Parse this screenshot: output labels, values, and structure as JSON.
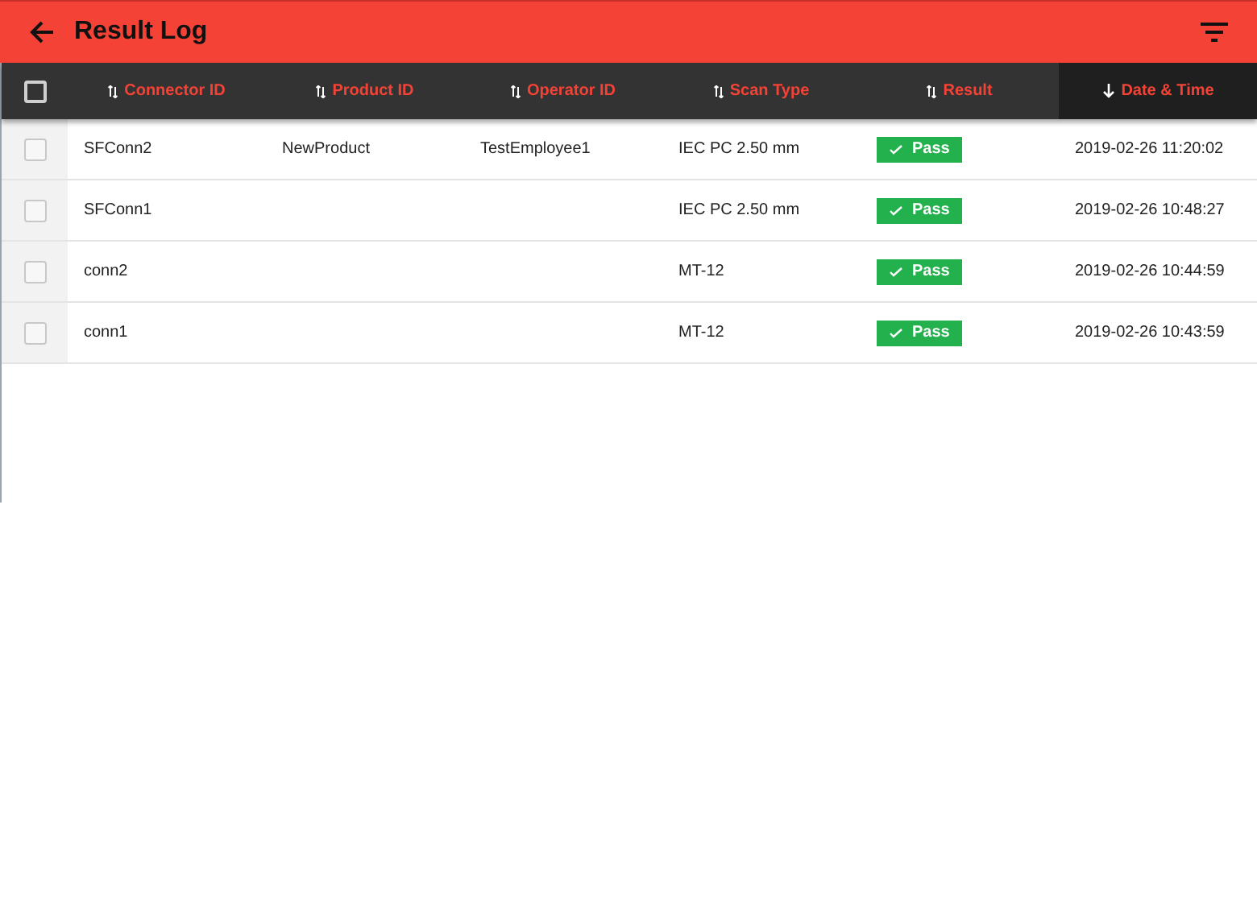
{
  "app_bar": {
    "title": "Result Log"
  },
  "table": {
    "select_all": {
      "checked": false
    },
    "columns": [
      {
        "label": "Connector ID",
        "selected": false
      },
      {
        "label": "Product ID",
        "selected": false
      },
      {
        "label": "Operator ID",
        "selected": false
      },
      {
        "label": "Scan Type",
        "selected": false
      },
      {
        "label": "Result",
        "selected": false
      },
      {
        "label": "Date & Time",
        "selected": true
      }
    ],
    "rows": [
      {
        "checked": false,
        "connector_id": "SFConn2",
        "product_id": "NewProduct",
        "operator_id": "TestEmployee1",
        "scan_type": "IEC PC 2.50 mm",
        "result": {
          "label": "Pass",
          "kind": "pass"
        },
        "date_time": "2019-02-26 11:20:02"
      },
      {
        "checked": false,
        "connector_id": "SFConn1",
        "scan_type": "IEC PC 2.50 mm",
        "result": {
          "label": "Pass",
          "kind": "pass"
        },
        "date_time": "2019-02-26 10:48:27"
      },
      {
        "checked": false,
        "connector_id": "conn2",
        "scan_type": "MT-12",
        "result": {
          "label": "Pass",
          "kind": "pass"
        },
        "date_time": "2019-02-26 10:44:59"
      },
      {
        "checked": false,
        "connector_id": "conn1",
        "scan_type": "MT-12",
        "result": {
          "label": "Pass",
          "kind": "pass"
        },
        "date_time": "2019-02-26 10:43:59"
      }
    ]
  }
}
